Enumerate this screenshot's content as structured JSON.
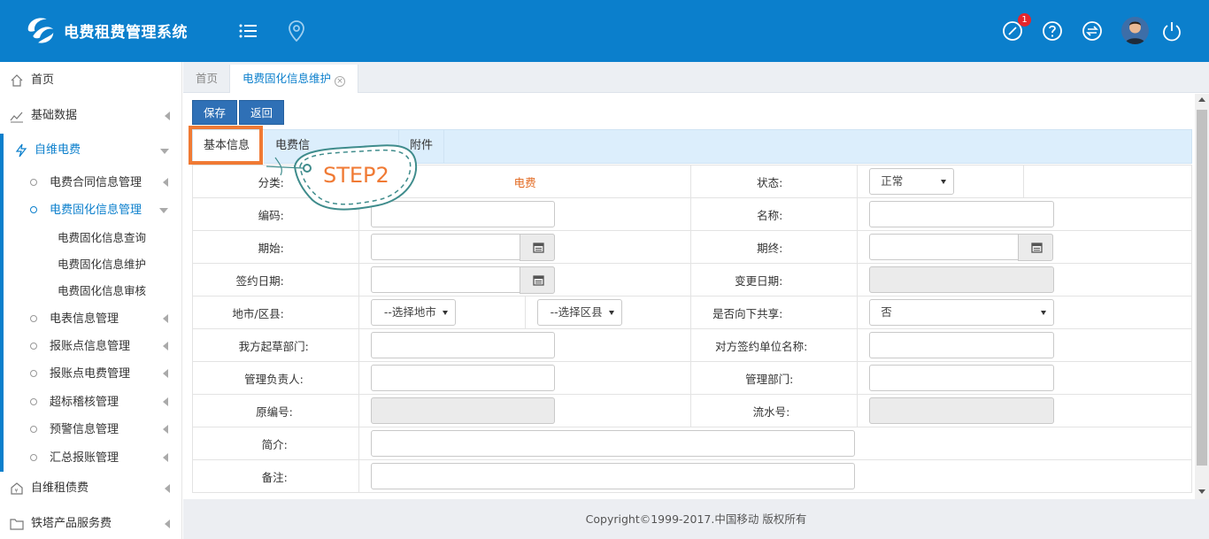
{
  "header": {
    "app_title": "电费租费管理系统",
    "notification_count": "1",
    "brand_color": "#0b7fcc"
  },
  "sidebar": {
    "items": [
      {
        "label": "首页",
        "icon": "home-icon"
      },
      {
        "label": "基础数据",
        "icon": "chart-line-icon"
      },
      {
        "label": "自维电费",
        "icon": "lightning-icon"
      },
      {
        "label": "自维租债费",
        "icon": "house-money-icon"
      },
      {
        "label": "铁塔产品服务费",
        "icon": "folder-icon"
      }
    ],
    "sub_items": [
      {
        "label": "电费合同信息管理"
      },
      {
        "label": "电费固化信息管理"
      },
      {
        "label": "电表信息管理"
      },
      {
        "label": "报账点信息管理"
      },
      {
        "label": "报账点电费管理"
      },
      {
        "label": "超标稽核管理"
      },
      {
        "label": "预警信息管理"
      },
      {
        "label": "汇总报账管理"
      }
    ],
    "leaf_items": [
      {
        "label": "电费固化信息查询"
      },
      {
        "label": "电费固化信息维护"
      },
      {
        "label": "电费固化信息审核"
      }
    ]
  },
  "tabs": [
    {
      "label": "首页"
    },
    {
      "label": "电费固化信息维护"
    }
  ],
  "toolbar": {
    "save_label": "保存",
    "back_label": "返回"
  },
  "subtabs": [
    {
      "label": "基本信息"
    },
    {
      "label": "电费信"
    },
    {
      "label": "附件"
    }
  ],
  "annotation": {
    "step_label": "STEP2",
    "highlight_color": "#f07a34",
    "tag_color": "#3f8c8c"
  },
  "form": {
    "category_label": "分类:",
    "category_value": "电费",
    "status_label": "状态:",
    "status_value": "正常",
    "code_label": "编码:",
    "name_label": "名称:",
    "start_label": "期始:",
    "end_label": "期终:",
    "sign_date_label": "签约日期:",
    "change_date_label": "变更日期:",
    "region_label": "地市/区县:",
    "city_placeholder": "--选择地市",
    "district_placeholder": "--选择区县",
    "share_label": "是否向下共享:",
    "share_value": "否",
    "draft_dept_label": "我方起草部门:",
    "counterparty_label": "对方签约单位名称:",
    "manager_label": "管理负责人:",
    "manage_dept_label": "管理部门:",
    "orig_code_label": "原编号:",
    "serial_label": "流水号:",
    "intro_label": "简介:",
    "remark_label": "备注:"
  },
  "footer": {
    "copyright": "Copyright©1999-2017.中国移动 版权所有"
  }
}
